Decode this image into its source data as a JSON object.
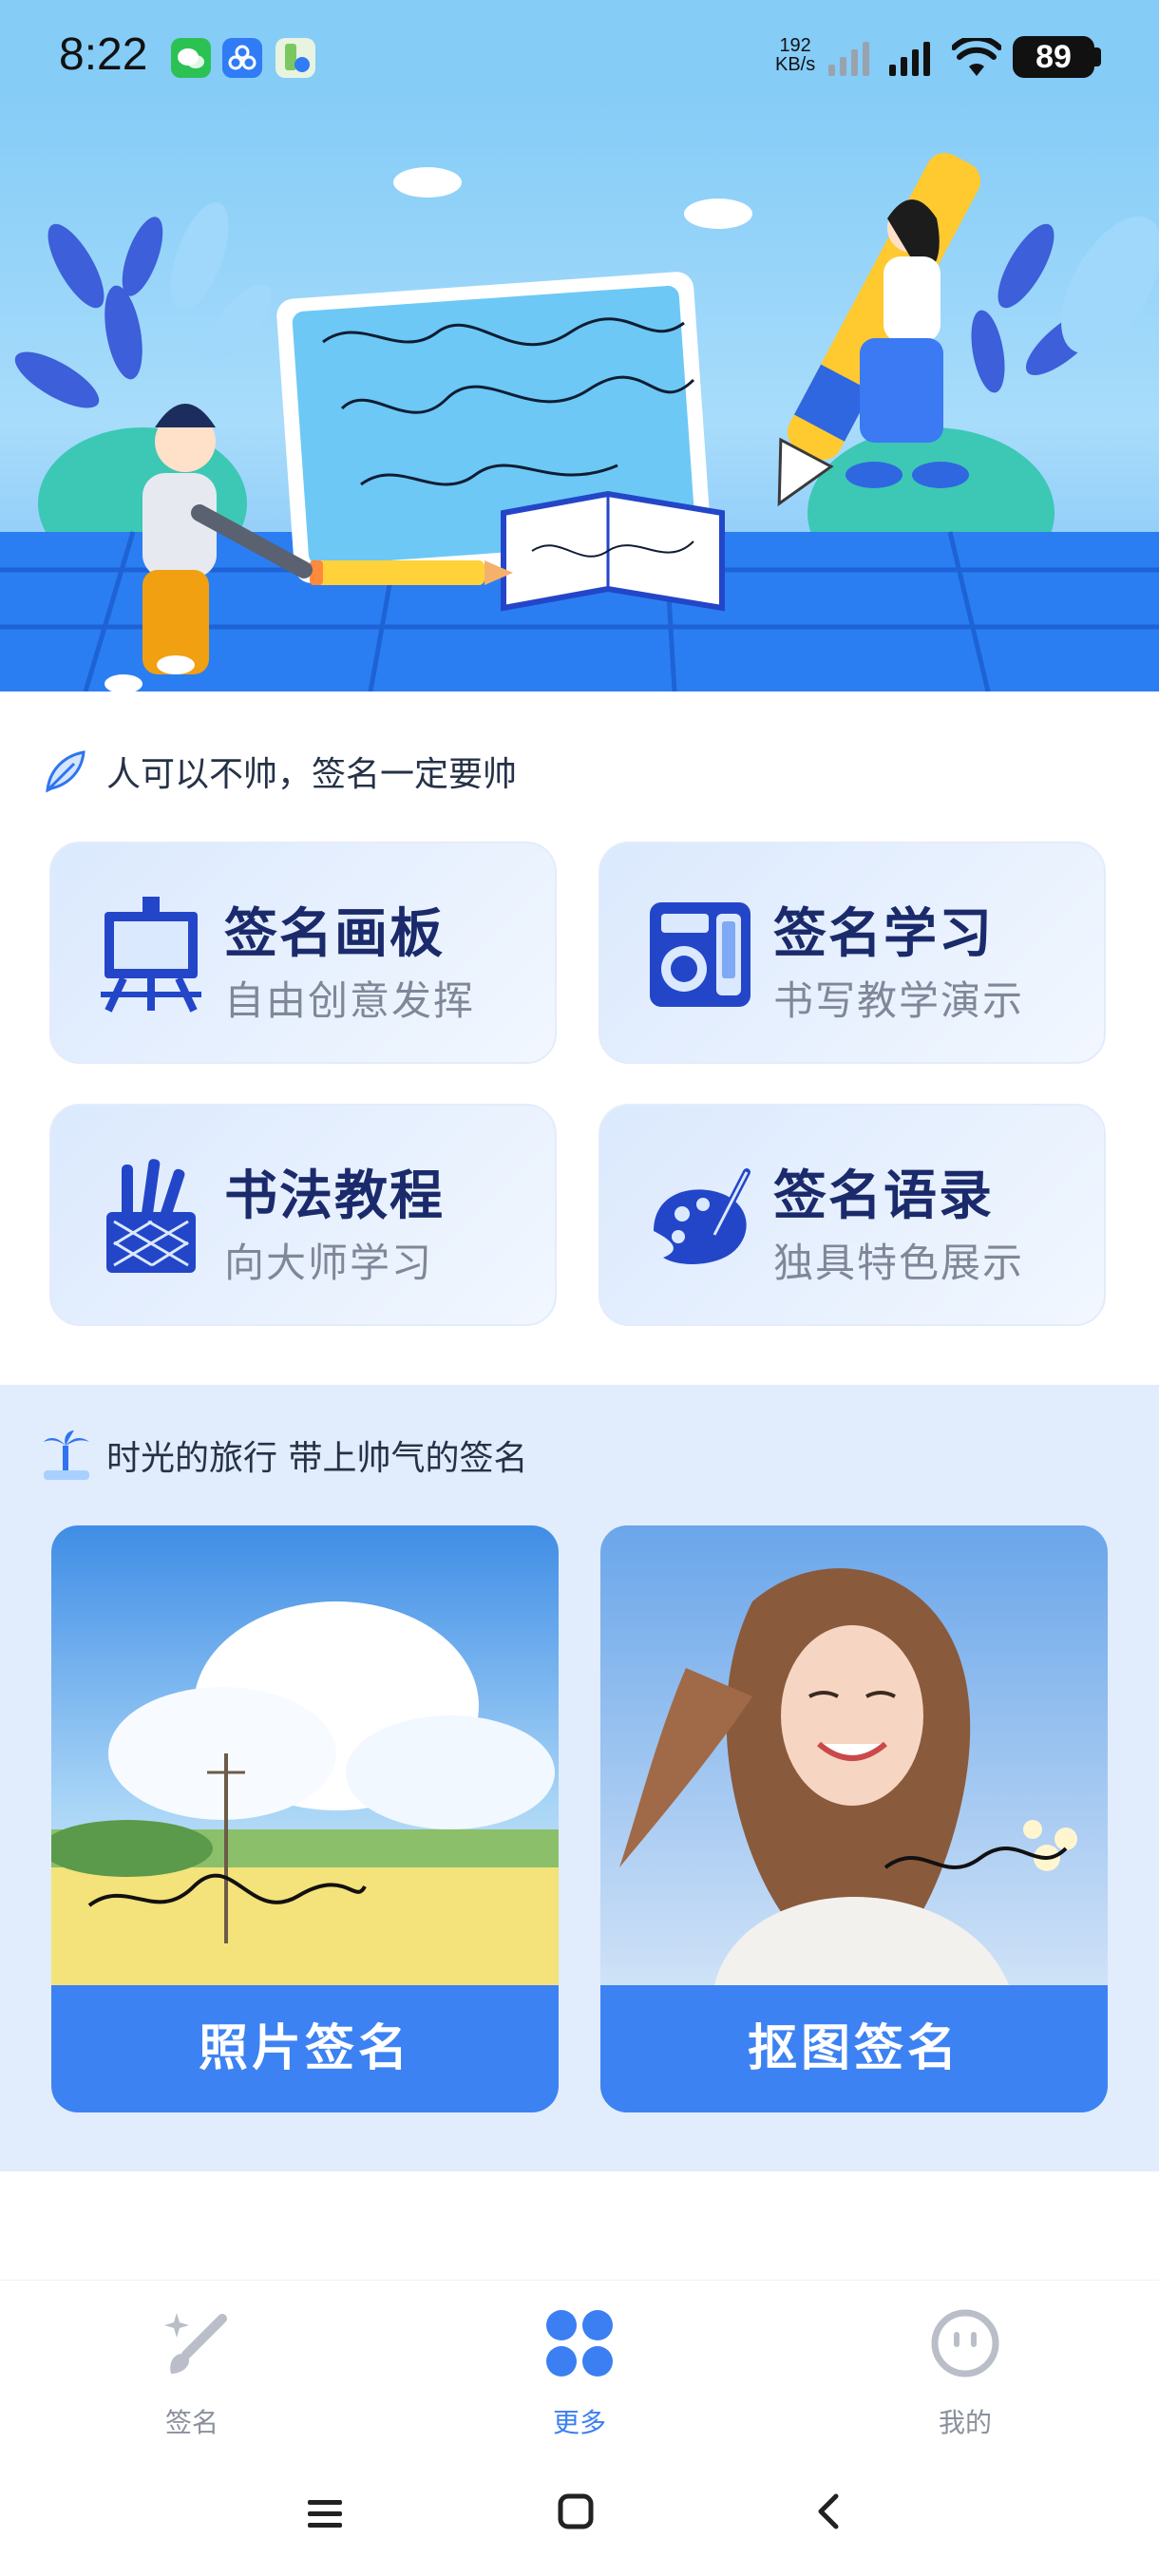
{
  "status_bar": {
    "time": "8:22",
    "net_speed_value": "192",
    "net_speed_unit": "KB/s",
    "battery": "89"
  },
  "section1": {
    "title": "人可以不帅，签名一定要帅",
    "cards": [
      {
        "title": "签名画板",
        "subtitle": "自由创意发挥",
        "icon": "easel-icon"
      },
      {
        "title": "签名学习",
        "subtitle": "书写教学演示",
        "icon": "device-icon"
      },
      {
        "title": "书法教程",
        "subtitle": "向大师学习",
        "icon": "pen-holder-icon"
      },
      {
        "title": "签名语录",
        "subtitle": "独具特色展示",
        "icon": "palette-icon"
      }
    ]
  },
  "section2": {
    "title": "时光的旅行 带上帅气的签名",
    "cards": [
      {
        "label": "照片签名"
      },
      {
        "label": "抠图签名"
      }
    ]
  },
  "bottom_nav": {
    "items": [
      {
        "label": "签名",
        "icon": "sparkle-brush-icon"
      },
      {
        "label": "更多",
        "icon": "grid-icon",
        "active": true
      },
      {
        "label": "我的",
        "icon": "smiley-icon"
      }
    ]
  },
  "colors": {
    "accent": "#3d82f2",
    "banner_sky": "#85ccf7",
    "card_title": "#1b2a6b",
    "section_bg": "#e1ecfd"
  }
}
